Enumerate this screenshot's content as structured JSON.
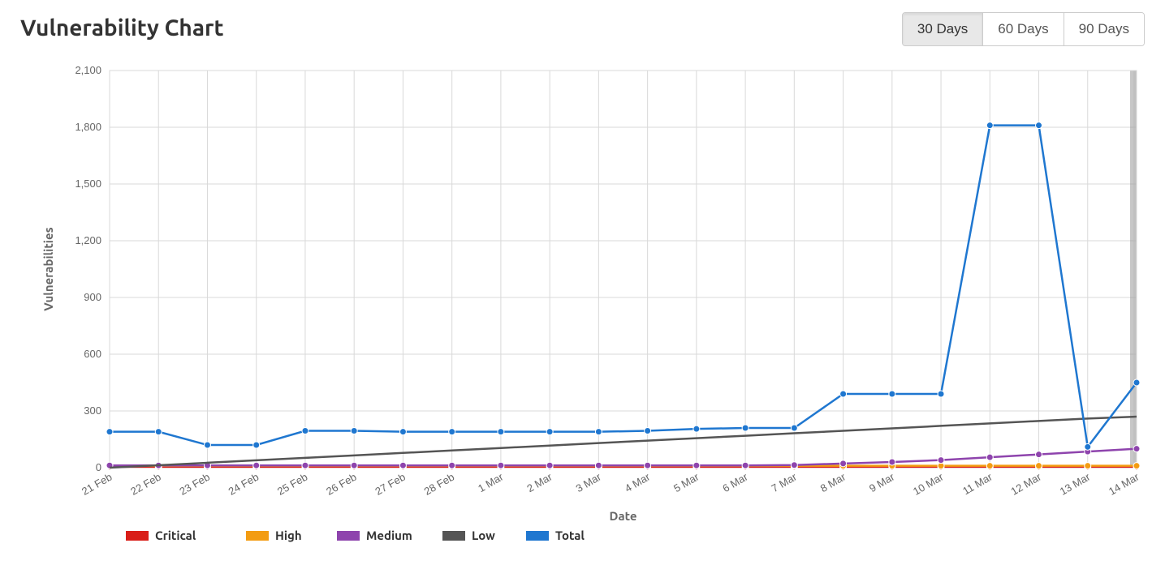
{
  "title": "Vulnerability Chart",
  "range_buttons": [
    {
      "label": "30 Days",
      "active": true
    },
    {
      "label": "60 Days",
      "active": false
    },
    {
      "label": "90 Days",
      "active": false
    }
  ],
  "chart_data": {
    "type": "line",
    "xlabel": "Date",
    "ylabel": "Vulnerabilities",
    "ylim": [
      0,
      2100
    ],
    "yticks": [
      0,
      300,
      600,
      900,
      1200,
      1500,
      1800,
      2100
    ],
    "categories": [
      "21 Feb",
      "22 Feb",
      "23 Feb",
      "24 Feb",
      "25 Feb",
      "26 Feb",
      "27 Feb",
      "28 Feb",
      "1 Mar",
      "2 Mar",
      "3 Mar",
      "4 Mar",
      "5 Mar",
      "6 Mar",
      "7 Mar",
      "8 Mar",
      "9 Mar",
      "10 Mar",
      "11 Mar",
      "12 Mar",
      "13 Mar",
      "14 Mar"
    ],
    "series": [
      {
        "name": "Critical",
        "color": "#D91E18",
        "values": [
          5,
          5,
          5,
          5,
          5,
          5,
          5,
          5,
          5,
          5,
          5,
          5,
          5,
          5,
          5,
          5,
          5,
          5,
          5,
          5,
          5,
          5
        ]
      },
      {
        "name": "High",
        "color": "#F39C12",
        "values": [
          10,
          10,
          10,
          10,
          10,
          10,
          10,
          10,
          10,
          10,
          10,
          10,
          10,
          10,
          10,
          10,
          10,
          10,
          10,
          10,
          10,
          10
        ]
      },
      {
        "name": "Medium",
        "color": "#8E44AD",
        "values": [
          12,
          12,
          12,
          12,
          12,
          12,
          12,
          12,
          12,
          12,
          12,
          12,
          12,
          12,
          14,
          22,
          30,
          40,
          55,
          70,
          85,
          100
        ]
      },
      {
        "name": "Low",
        "color": "#555555",
        "values": [
          0,
          13,
          26,
          39,
          52,
          65,
          78,
          91,
          104,
          117,
          130,
          143,
          156,
          169,
          182,
          195,
          208,
          221,
          234,
          247,
          260,
          270
        ],
        "noMarkers": true
      },
      {
        "name": "Total",
        "color": "#1F77D0",
        "values": [
          190,
          190,
          120,
          120,
          195,
          195,
          190,
          190,
          190,
          190,
          190,
          195,
          205,
          210,
          210,
          390,
          390,
          390,
          1810,
          1810,
          110,
          450
        ]
      }
    ],
    "legend": [
      "Critical",
      "High",
      "Medium",
      "Low",
      "Total"
    ]
  }
}
